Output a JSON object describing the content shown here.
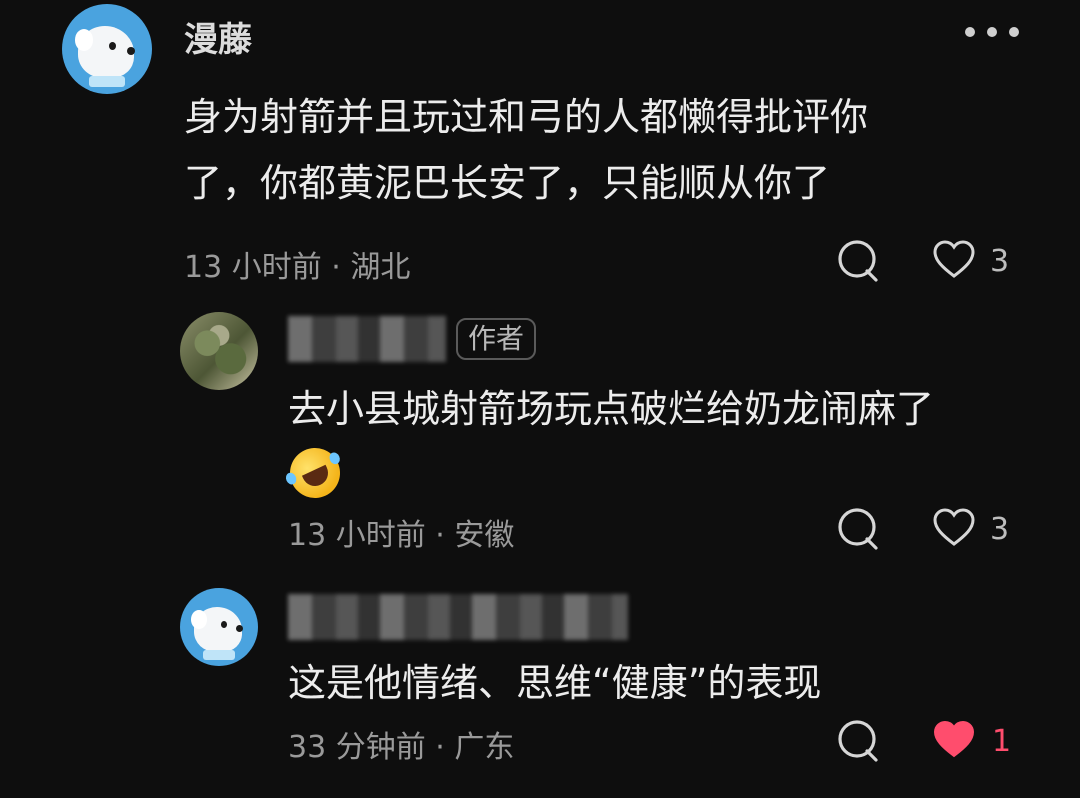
{
  "top_comment": {
    "username": "漫藤",
    "text_line1": "身为射箭并且玩过和弓的人都懒得批评你",
    "text_line2": "了，你都黄泥巴长安了，只能顺从你了",
    "meta": "13 小时前 · 湖北",
    "like_count": "3",
    "more_icon": "more-dots-icon"
  },
  "reply1": {
    "author_badge": "作者",
    "text_line1": "去小县城射箭场玩点破烂给奶龙闹麻了",
    "emoji": "rolling-on-floor-laughing-emoji",
    "meta": "13 小时前 · 安徽",
    "like_count": "3"
  },
  "reply2": {
    "text_line1": "这是他情绪、思维“健康”的表现",
    "meta": "33 分钟前 · 广东",
    "like_count": "1",
    "liked_color": "#ff4d6d"
  }
}
